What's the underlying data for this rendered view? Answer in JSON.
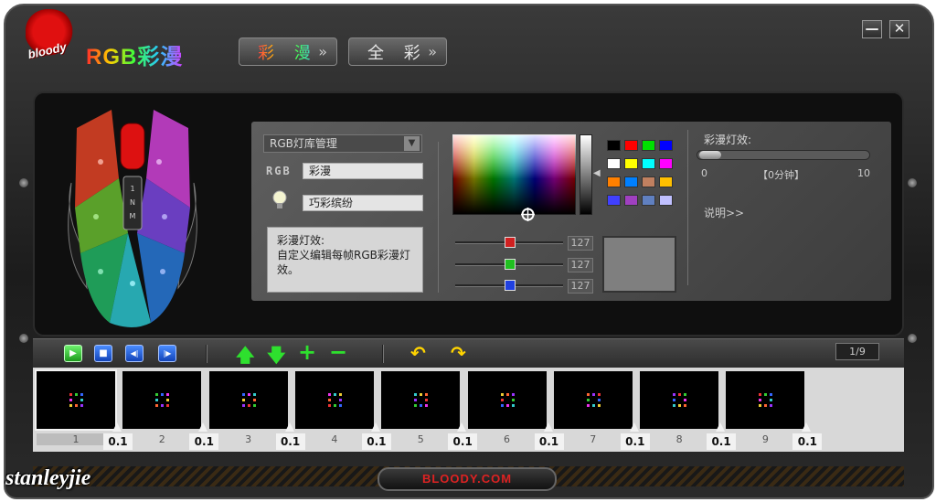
{
  "window": {
    "brand_logo": "bloody",
    "title": "RGB彩漫",
    "minimize_label": "—",
    "close_label": "✕"
  },
  "tabs": [
    {
      "label": "彩 漫",
      "active": true
    },
    {
      "label": "全 彩",
      "active": false
    }
  ],
  "editor": {
    "library_select": "RGB灯库管理",
    "rgb_label": "RGB",
    "rgb_name": "彩漫",
    "effect_name": "巧彩缤纷",
    "description": "彩漫灯效:\n自定义编辑每帧RGB彩漫灯效。"
  },
  "color_picker": {
    "swatches": [
      "#000000",
      "#ff0000",
      "#00e000",
      "#0000ff",
      "#ffffff",
      "#ffff00",
      "#00ffff",
      "#ff00ff",
      "#ff8000",
      "#0080ff",
      "#c08060",
      "#ffc000",
      "#4040ff",
      "#a040c0",
      "#6080c0",
      "#c0c0ff"
    ],
    "sliders": [
      {
        "channel": "red",
        "value": "127",
        "color": "#d02020"
      },
      {
        "channel": "green",
        "value": "127",
        "color": "#20c020"
      },
      {
        "channel": "blue",
        "value": "127",
        "color": "#2040e0"
      }
    ],
    "preview_color": "#7f7f7f"
  },
  "effect_panel": {
    "label": "彩漫灯效:",
    "min": "0",
    "max": "10",
    "current": "【0分钟】",
    "help_link": "说明>>",
    "level": 0
  },
  "toolbar": {
    "play": "▶",
    "stop": "■",
    "prev": "◀|",
    "next": "|▶",
    "move_up": "🡅",
    "move_down": "🡇",
    "add": "+",
    "remove": "−",
    "undo": "↶",
    "redo": "↷",
    "page": "1/9"
  },
  "frames": [
    {
      "number": "1",
      "time": "0.1",
      "selected": true
    },
    {
      "number": "2",
      "time": "0.1",
      "selected": false
    },
    {
      "number": "3",
      "time": "0.1",
      "selected": false
    },
    {
      "number": "4",
      "time": "0.1",
      "selected": false
    },
    {
      "number": "5",
      "time": "0.1",
      "selected": false
    },
    {
      "number": "6",
      "time": "0.1",
      "selected": false
    },
    {
      "number": "7",
      "time": "0.1",
      "selected": false
    },
    {
      "number": "8",
      "time": "0.1",
      "selected": false
    },
    {
      "number": "9",
      "time": "0.1",
      "selected": false
    }
  ],
  "footer": {
    "site": "BLOODY.COM",
    "watermark": "stanleyjie"
  }
}
